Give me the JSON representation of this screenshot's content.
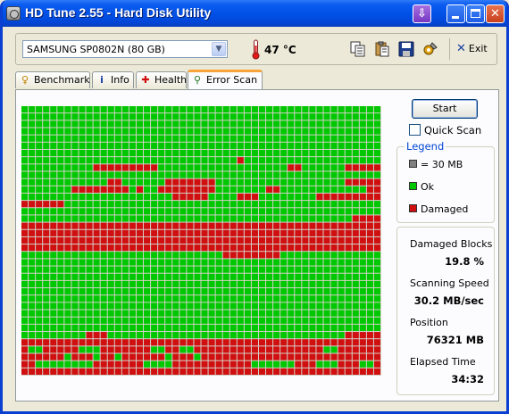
{
  "window": {
    "title": "HD Tune 2.55 - Hard Disk Utility"
  },
  "toolbar": {
    "drive": "SAMSUNG SP0802N (80 GB)",
    "temperature": "47 °C",
    "exit_label": "Exit",
    "icons": [
      "copy-icon",
      "paste-icon",
      "save-icon",
      "options-icon"
    ]
  },
  "tabs": [
    {
      "label": "Benchmark",
      "icon": "benchmark-icon",
      "active": false
    },
    {
      "label": "Info",
      "icon": "info-icon",
      "active": false
    },
    {
      "label": "Health",
      "icon": "health-icon",
      "active": false
    },
    {
      "label": "Error Scan",
      "icon": "magnifier-icon",
      "active": true
    }
  ],
  "scan": {
    "start_label": "Start",
    "quick_scan_label": "Quick Scan",
    "quick_scan_checked": false,
    "colors": {
      "ok": "#00c800",
      "damaged": "#d01010",
      "unit": "#808080"
    },
    "grid_cols": 50,
    "grid_rows": 37,
    "grid_rows_data": [
      "GGGGGGGGGGGGGGGGGGGGGGGGGGGGGGGGGGGGGGGGGGGGGGGGGG",
      "GGGGGGGGGGGGGGGGGGGGGGGGGGGGGGGGGGGGGGGGGGGGGGGGGG",
      "GGGGGGGGGGGGGGGGGGGGGGGGGGGGGGGGGGGGGGGGGGGGGGGGGG",
      "GGGGGGGGGGGGGGGGGGGGGGGGGGGGGGGGGGGGGGGGGGGGGGGGGG",
      "GGGGGGGGGGGGGGGGGGGGGGGGGGGGGGGGGGGGGGGGGGGGGGGGGG",
      "GGGGGGGGGGGGGGGGGGGGGGGGGGGGGGGGGGGGGGGGGGGGGGGGGG",
      "GGGGGGGGGGGGGGGGGGGGGGGGGGGGGGGGGGGGGGGGGGGGGGGGGG",
      "GGGGGGGGGGGGGGGGGGGGGGGGGGGGGGRGGGGGGGGGGGGGGGGGGG",
      "GGGGGGGGGGRRRRRRRRRGGGGGGGGGGGGGGGGGGRRGGGGGGRRRRRR",
      "GGGGGGGGGGGGGGGGGGGGGGGGGGGGGGGGGGGGGGGGGGGGGGGGGG",
      "GGGGGGGGGGGGRRGGGGGGRRRRRRRGGGGGGGGGGGGGGGGGGRRRRRR",
      "GGGGGGGRRRRRRRRGRGGRRRRRRRRGGGGGGGRRGGGGGGGGGGGGRRR",
      "GGGGGGGGGGGGGGGGGGGGGRRRRRGGGGRRRGGGGGGGGRRRRRRRRR",
      "RRRRRRGGGGGGGGGGGGGGGGGGGGGGGGGGGGGGGGGGGGGGGGGGGG",
      "GGGGGGGGGGGGGGGGGGGGGGGGGGGGGGGGGGGGGGGGGGGGGGGGGG",
      "GGGGGGGGGGGGGGGGGGGGGGGGGGGGGGGGGGGGGGGGGGGGGGRRRRR",
      "RRRRRRRRRRRRRRRRRRRRRRRRRRRRRRRRRRRRRRRRRRRRRRRRRR",
      "RRRRRRRRRRRRRRRRRRRRRRRRRRRRRRRRRRRRRRRRRRRRRRRRRR",
      "RRRRRRRRRRRRRRRRRRRRRRRRRRRRRRRRRRRRRRRRRRRRRRRRRR",
      "RRRRRRRRRRRRRRRRRRRRRRRRRRRRRRRRRRRRRRRRRRRRRRRRRR",
      "GGGGGGGGGGGGGGGGGGGGGGGGGGGGRRRRRRRRGGGGGGGGGGGGGGG",
      "GGGGGGGGGGGGGGGGGGGGGGGGGGGGGGGGGGGGGGGGGGGGGGGGGG",
      "GGGGGGGGGGGGGGGGGGGGGGGGGGGGGGGGGGGGGGGGGGGGGGGGGG",
      "GGGGGGGGGGGGGGGGGGGGGGGGGGGGGGGGGGGGGGGGGGGGGGGGGG",
      "GGGGGGGGGGGGGGGGGGGGGGGGGGGGGGGGGGGGGGGGGGGGGGGGGG",
      "GGGGGGGGGGGGGGGGGGGGGGGGGGGGGGGGGGGGGGGGGGGGGGGGGG",
      "GGGGGGGGGGGGGGGGGGGGGGGGGGGGGGGGGGGGGGGGGGGGGGGGGG",
      "GGGGGGGGGGGGGGGGGGGGGGGGGGGGGGGGGGGGGGGGGGGGGGGGGG",
      "GGGGGGGGGGGGGGGGGGGGGGGGGGGGGGGGGGGGGGGGGGGGGGGGGG",
      "GGGGGGGGGGGGGGGGGGGGGGGGGGGGGGGGGGGGGGGGGGGGGGGGGG",
      "GGGGGGGGGGGGGGGGGGGGGGGGGGGGGGGGGGGGGGGGGGGGGGGGGG",
      "GGGGGGGGGRRRGGGGGGGGGGGGGGGGGGGGGGGGGGGGGGGGGRRRRRG",
      "RRRRRRRRRRRRRRRRRRRRRRRRRRRRRRRRRRRRRRRRRRRRRRRRRR",
      "RGGRRRRRGGGRRRRRRRGGRRGGRRRRRRRRRRRRRRRRRRGGRRRRRRR",
      "RRRRRRGRRRGRRGRRRRRRGRRRGRRRRRRRRRRRRRRRRRRRRRRRRR",
      "RRGGGGGGGGRRRRRRRGGGGRRRRRRRRRRRGGGGGGRRRGGGRRRGGR",
      "RRRRRRRRRRRRRRRRRRRRRRRRRRRRRRRRRRRRRRRRRRRRRRRRRR"
    ]
  },
  "legend": {
    "title": "Legend",
    "unit_label": "= 30 MB",
    "ok_label": "Ok",
    "damaged_label": "Damaged"
  },
  "stats": {
    "damaged_blocks_label": "Damaged Blocks",
    "damaged_blocks_value": "19.8 %",
    "scanning_speed_label": "Scanning Speed",
    "scanning_speed_value": "30.2 MB/sec",
    "position_label": "Position",
    "position_value": "76321 MB",
    "elapsed_label": "Elapsed Time",
    "elapsed_value": "34:32"
  }
}
